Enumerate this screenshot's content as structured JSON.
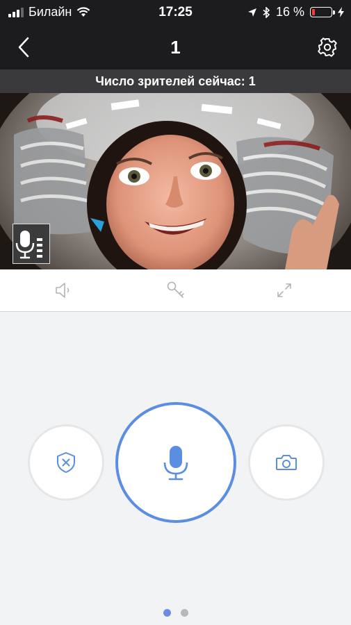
{
  "status_bar": {
    "carrier": "Билайн",
    "time": "17:25",
    "battery_percent": "16 %",
    "battery_level": 0.16
  },
  "nav": {
    "title": "1"
  },
  "viewers": {
    "text": "Число зрителей сейчас: 1"
  },
  "colors": {
    "accent": "#5b8de0",
    "dot_active": "#6e8ce5",
    "battery_low": "#ff3b30"
  },
  "pagination": {
    "total": 2,
    "active": 1
  },
  "icons": {
    "back": "chevron-left-icon",
    "settings": "gear-icon",
    "sound": "speaker-icon",
    "key": "key-icon",
    "fullscreen": "expand-icon",
    "security": "shield-x-icon",
    "talk": "microphone-icon",
    "snapshot": "camera-icon"
  }
}
